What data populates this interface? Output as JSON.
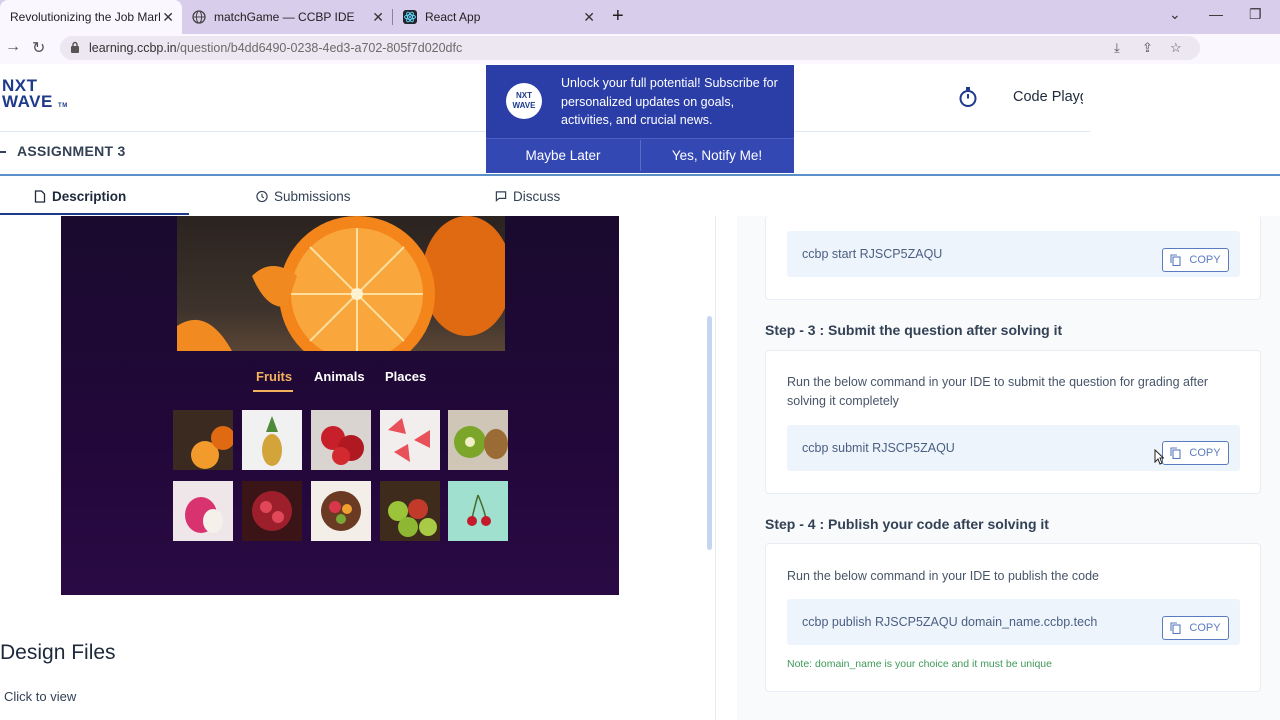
{
  "browser": {
    "tabs": [
      {
        "title": "Revolutionizing the Job Market |"
      },
      {
        "title": "matchGame — CCBP IDE"
      },
      {
        "title": "React App"
      }
    ],
    "url_host": "learning.ccbp.in",
    "url_path": "/question/b4dd6490-0238-4ed3-a702-805f7d020dfc"
  },
  "header": {
    "logo_line1": "NXT",
    "logo_line2": "WAVE",
    "logo_tm": "TM",
    "code_playground": "Code Playground",
    "assignment_title": "ASSIGNMENT 3"
  },
  "popup": {
    "logo_line1": "NXT",
    "logo_line2": "WAVE",
    "message": "Unlock your full potential! Subscribe for personalized updates on goals, activities, and crucial news.",
    "later_label": "Maybe Later",
    "notify_label": "Yes, Notify Me!"
  },
  "question_tabs": {
    "description": "Description",
    "submissions": "Submissions",
    "discuss": "Discuss"
  },
  "preview": {
    "categories": [
      "Fruits",
      "Animals",
      "Places"
    ]
  },
  "left": {
    "design_files": "Design Files",
    "click_to_view": "Click to view"
  },
  "steps": {
    "start_cmd": "ccbp start RJSCP5ZAQU",
    "step3_title": "Step - 3 : Submit the question after solving it",
    "step3_desc": "Run the below command in your IDE to submit the question for grading after solving it completely",
    "submit_cmd": "ccbp submit RJSCP5ZAQU",
    "step4_title": "Step - 4 : Publish your code after solving it",
    "step4_desc": "Run the below command in your IDE to publish the code",
    "publish_cmd": "ccbp publish RJSCP5ZAQU domain_name.ccbp.tech",
    "note": "Note: domain_name is your choice and it must be unique",
    "copy_label": "COPY"
  }
}
